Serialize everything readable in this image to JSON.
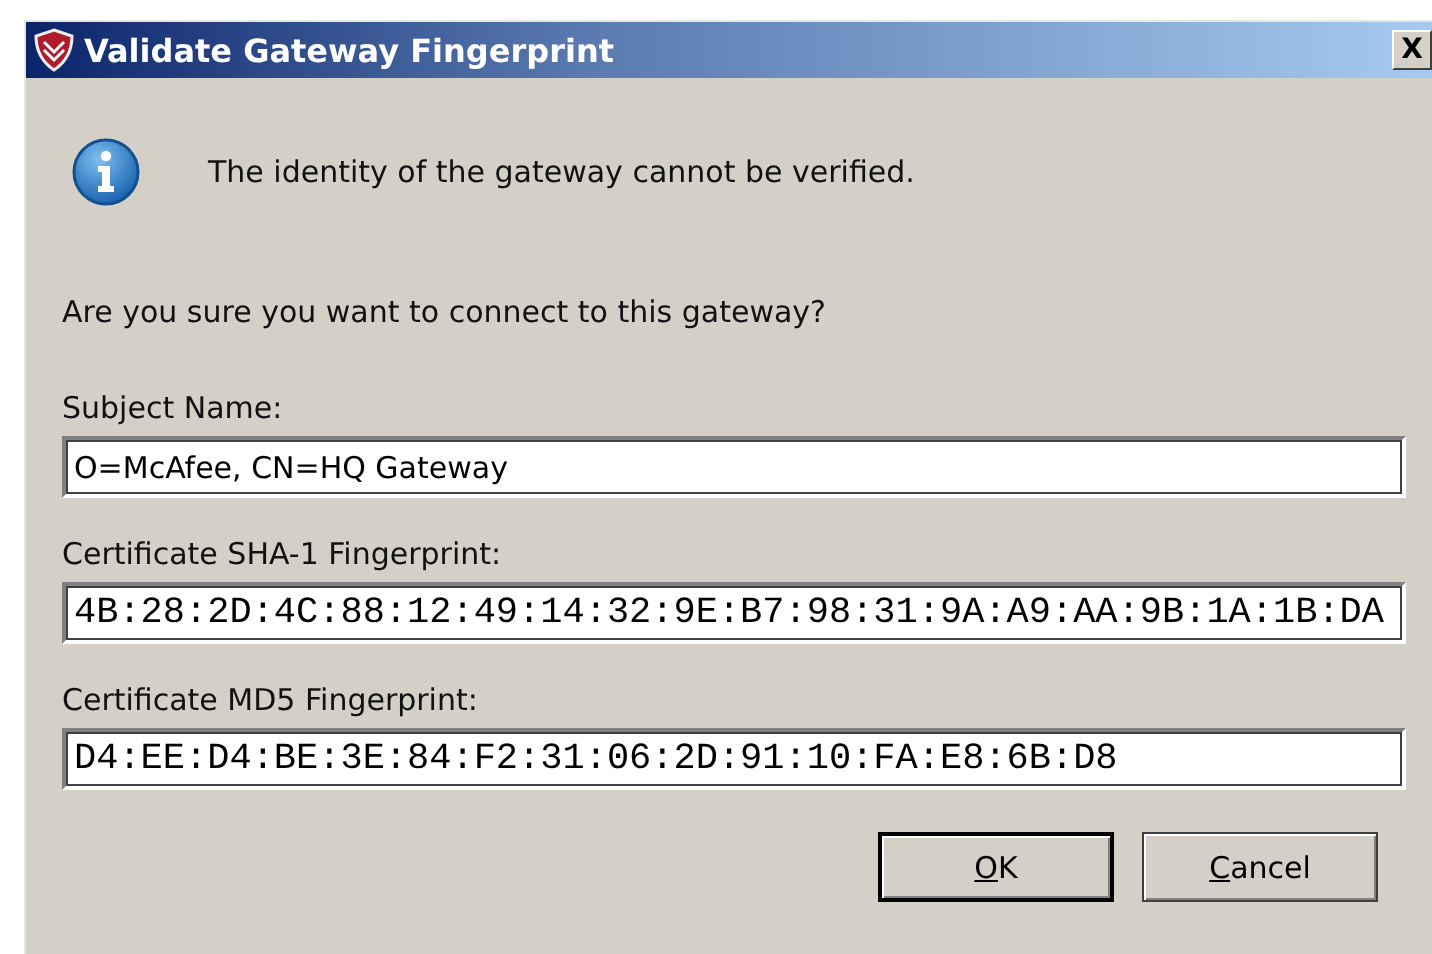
{
  "window": {
    "title": "Validate Gateway Fingerprint",
    "close": "X"
  },
  "message": "The identity of the gateway cannot be verified.",
  "question": "Are you sure you want to connect to this gateway?",
  "fields": [
    {
      "label": "Subject Name:",
      "value": "O=McAfee, CN=HQ Gateway",
      "kind": "text"
    },
    {
      "label": "Certificate SHA-1 Fingerprint:",
      "value": "4B:28:2D:4C:88:12:49:14:32:9E:B7:98:31:9A:A9:AA:9B:1A:1B:DA",
      "kind": "mono"
    },
    {
      "label": "Certificate MD5 Fingerprint:",
      "value": "D4:EE:D4:BE:3E:84:F2:31:06:2D:91:10:FA:E8:6B:D8",
      "kind": "mono"
    }
  ],
  "buttons": [
    {
      "access_key": "O",
      "label_rest": "K",
      "default": true
    },
    {
      "access_key": "C",
      "label_rest": "ancel",
      "default": false
    }
  ]
}
